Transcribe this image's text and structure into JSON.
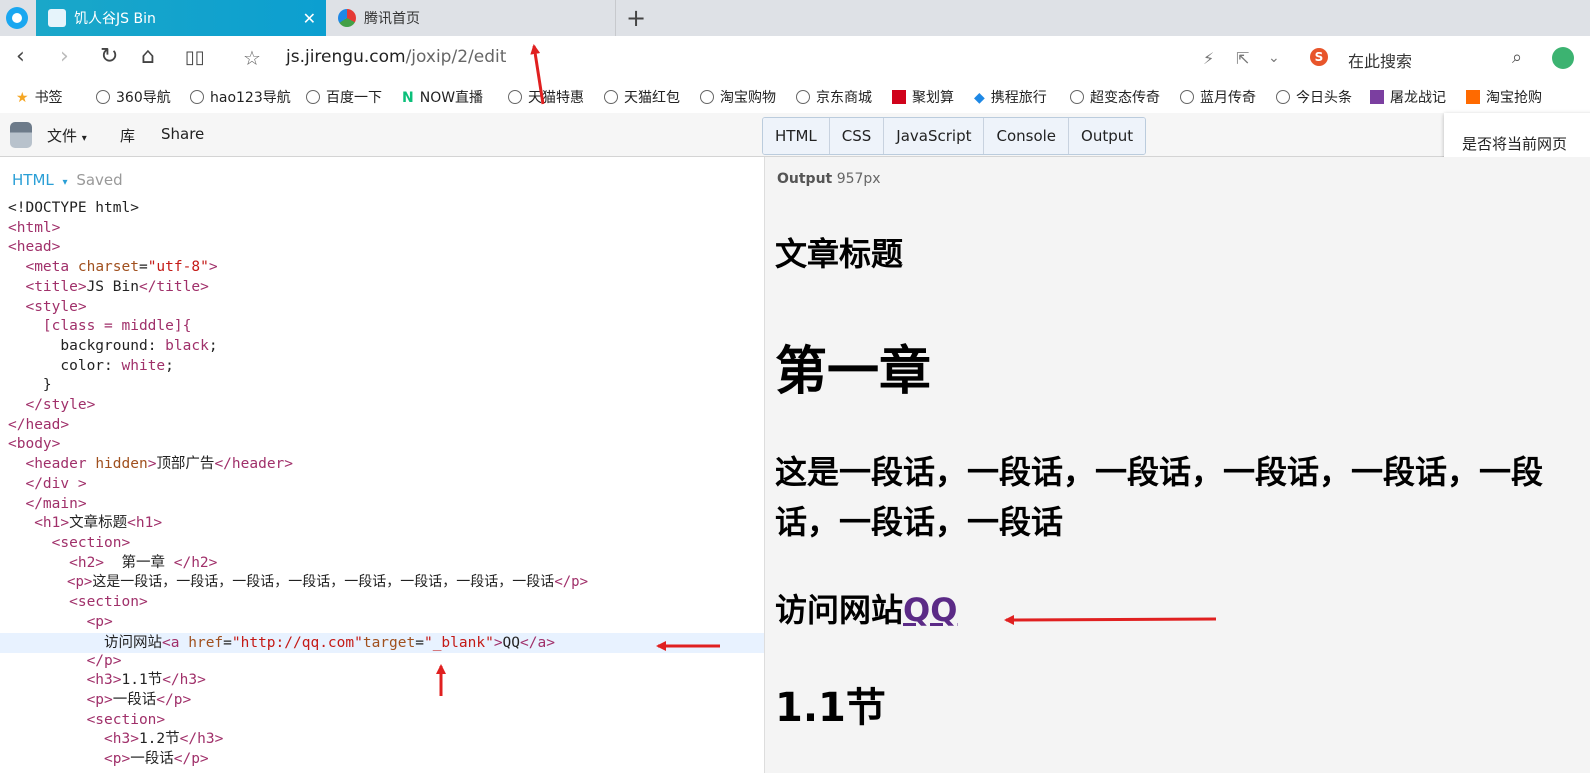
{
  "tabs": [
    {
      "label": "饥人谷JS Bin",
      "active": true
    },
    {
      "label": "腾讯首页",
      "active": false
    }
  ],
  "nav": {
    "url_host": "js.jirengu.com",
    "url_path": "/joxip/2/edit",
    "search_placeholder": "在此搜索"
  },
  "bookmarks": [
    "书签",
    "360导航",
    "hao123导航",
    "百度一下",
    "NOW直播",
    "天猫特惠",
    "天猫红包",
    "淘宝购物",
    "京东商城",
    "聚划算",
    "携程旅行",
    "超变态传奇",
    "蓝月传奇",
    "今日头条",
    "屠龙战记",
    "淘宝抢购"
  ],
  "jsbin": {
    "menu_file": "文件",
    "menu_lib": "库",
    "menu_share": "Share",
    "panels": [
      "HTML",
      "CSS",
      "JavaScript",
      "Console",
      "Output"
    ],
    "popup_text": "是否将当前网页"
  },
  "editor": {
    "panel_label": "HTML",
    "status": "Saved"
  },
  "output": {
    "label": "Output",
    "width_text": "957px",
    "h1": "文章标题",
    "h2": "第一章",
    "p1": "这是一段话，一段话，一段话，一段话，一段话，一段话，一段话，一段话",
    "link_prefix": "访问网站",
    "link_text": "QQ",
    "h3": "1.1节"
  },
  "code": {
    "l1": "<!DOCTYPE html>",
    "l6": "[class = middle]{",
    "l7a": "background: ",
    "l7b": "black",
    "l8a": "color: ",
    "l8b": "white",
    "l18": "顶部广告",
    "l22": "文章标题",
    "l24": "  第一章 ",
    "l25": "这是一段话，一段话，一段话，一段话，一段话，一段话，一段话，一段话",
    "l28a": "访问网站",
    "l28href": "\"http://qq.com\"",
    "l28target": "\"_blank\"",
    "l28c": "QQ",
    "l30": "1.1节",
    "l31": "一段话",
    "l33": "1.2节",
    "l34": "一段话"
  },
  "colors": {
    "accent": "#1aa7c9",
    "arrow": "#e02020",
    "link": "#5b2a86"
  }
}
